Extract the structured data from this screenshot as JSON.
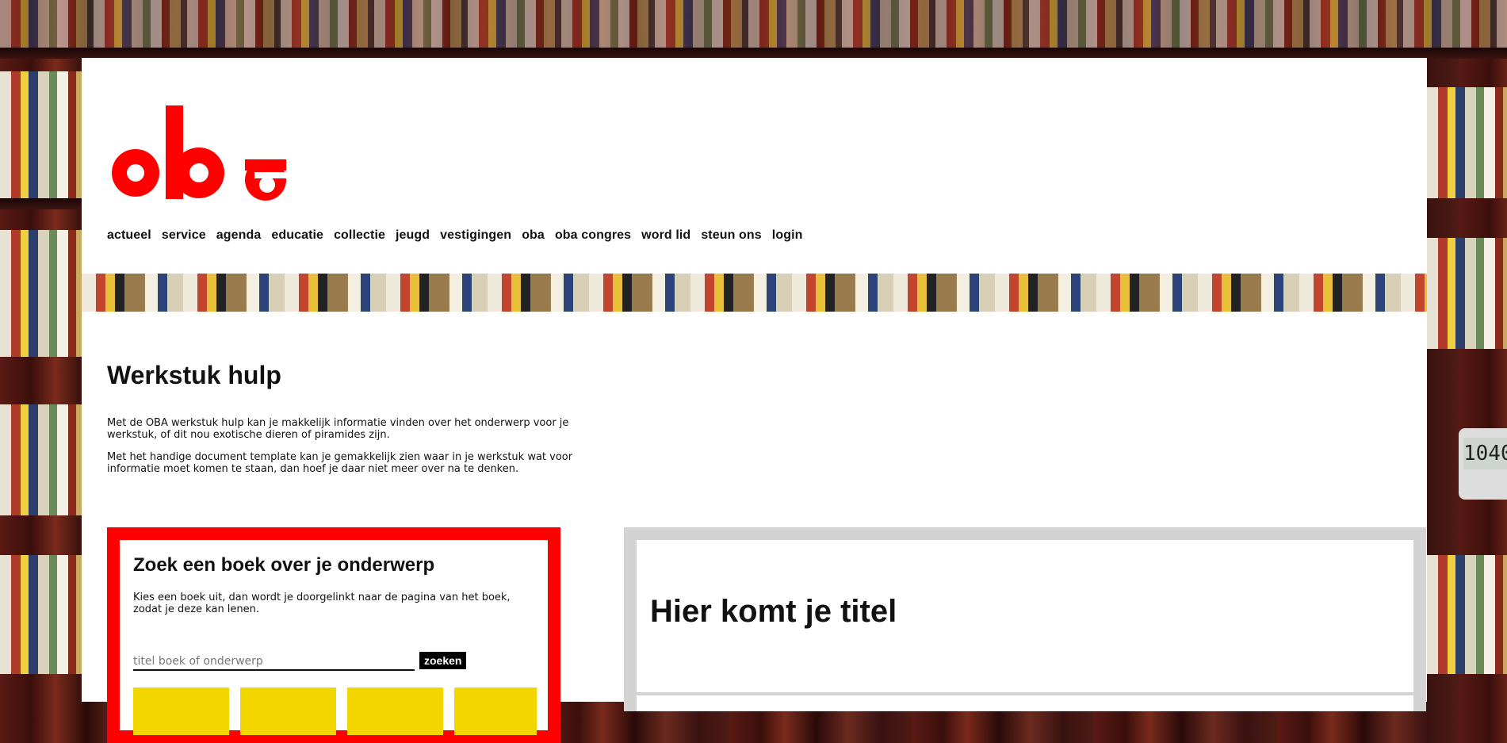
{
  "logo": {
    "text": "oba",
    "color": "#ff0000",
    "icon": "oba-logo"
  },
  "nav": {
    "items": [
      {
        "label": "actueel"
      },
      {
        "label": "service"
      },
      {
        "label": "agenda"
      },
      {
        "label": "educatie"
      },
      {
        "label": "collectie"
      },
      {
        "label": "jeugd"
      },
      {
        "label": "vestigingen"
      },
      {
        "label": "oba"
      },
      {
        "label": "oba congres"
      },
      {
        "label": "word lid"
      },
      {
        "label": "steun ons"
      },
      {
        "label": "login"
      }
    ]
  },
  "main": {
    "title": "Werkstuk hulp",
    "intro": [
      "Met de OBA werkstuk hulp kan je makkelijk informatie vinden over het onderwerp voor je werkstuk, of dit nou exotische dieren of piramides zijn.",
      "Met het handige document template kan je gemakkelijk zien waar in je werkstuk wat voor informatie moet komen te staan, dan hoef je daar niet meer over na te denken."
    ]
  },
  "search_panel": {
    "title": "Zoek een boek over je onderwerp",
    "description": "Kies een boek uit, dan wordt je doorgelinkt naar de pagina van het boek, zodat je deze kan lenen.",
    "input_placeholder": "titel boek of onderwerp",
    "input_value": "",
    "button_label": "zoeken",
    "border_color": "#ff0000",
    "tile_color": "#f2d600"
  },
  "document_panel": {
    "title": "Hier komt je titel",
    "border_color": "#d3d3d3"
  },
  "background": {
    "clock_text": "1040"
  }
}
